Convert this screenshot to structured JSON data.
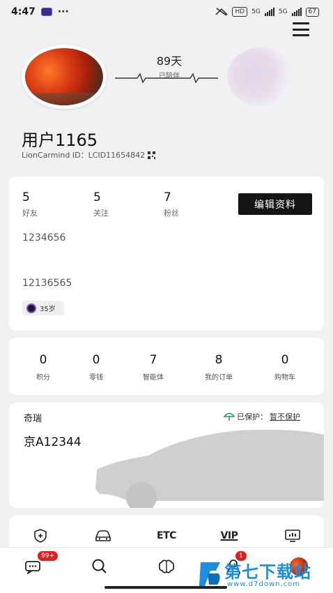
{
  "status_bar": {
    "time": "4:47",
    "more": "···",
    "hd": "HD",
    "net1": "5G",
    "net2": "5G",
    "battery": "67"
  },
  "profile": {
    "days": "89天",
    "days_label": "已陪伴",
    "username": "用户1165",
    "id_text": "LionCarmind ID：LCID11654842"
  },
  "stats": [
    {
      "value": "5",
      "label": "好友"
    },
    {
      "value": "5",
      "label": "关注"
    },
    {
      "value": "7",
      "label": "粉丝"
    }
  ],
  "edit_button": "编辑资料",
  "bio_line1": "1234656",
  "bio_line2": "12136565",
  "age_chip": "35岁",
  "wallet": [
    {
      "value": "0",
      "label": "积分"
    },
    {
      "value": "0",
      "label": "零钱"
    },
    {
      "value": "7",
      "label": "智能体"
    },
    {
      "value": "8",
      "label": "我的订单"
    },
    {
      "value": "0",
      "label": "购物车"
    }
  ],
  "car": {
    "brand": "奇瑞",
    "plate": "京A12344",
    "protect_status": "已保护：",
    "protect_link": "暂不保护"
  },
  "quick_actions": [
    "shield-plus-icon",
    "car-front-icon",
    "ETC",
    "VIP",
    "monitor-chart-icon"
  ],
  "quick_text": {
    "etc": "ETC",
    "vip": "VIP"
  },
  "tabbar": {
    "messages_badge": "99+",
    "avatar_badge": "1"
  },
  "watermark": {
    "title": "第七下载站",
    "url": "www.d7down.com"
  }
}
